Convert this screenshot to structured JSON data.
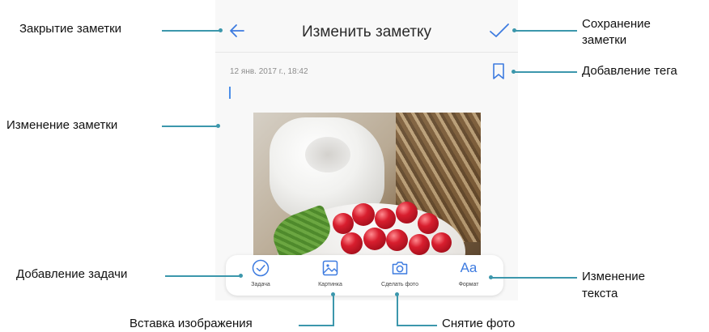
{
  "screen": {
    "title": "Изменить заметку",
    "date": "12 янв. 2017 г., 18:42"
  },
  "toolbar": {
    "items": [
      {
        "label": "Задача",
        "icon": "checkmark-circle-icon"
      },
      {
        "label": "Картинка",
        "icon": "image-icon"
      },
      {
        "label": "Сделать фото",
        "icon": "camera-icon"
      },
      {
        "label": "Формат",
        "icon": "text-format-icon",
        "glyph": "Aa"
      }
    ]
  },
  "callouts": {
    "close": "Закрытие заметки",
    "save_line1": "Сохранение",
    "save_line2": "заметки",
    "tag": "Добавление тега",
    "edit": "Изменение заметки",
    "task": "Добавление задачи",
    "text_line1": "Изменение",
    "text_line2": "текста",
    "insert_image": "Вставка изображения",
    "take_photo": "Снятие фото"
  },
  "colors": {
    "accent": "#3d7be0",
    "callout_line": "#3c97ac"
  }
}
